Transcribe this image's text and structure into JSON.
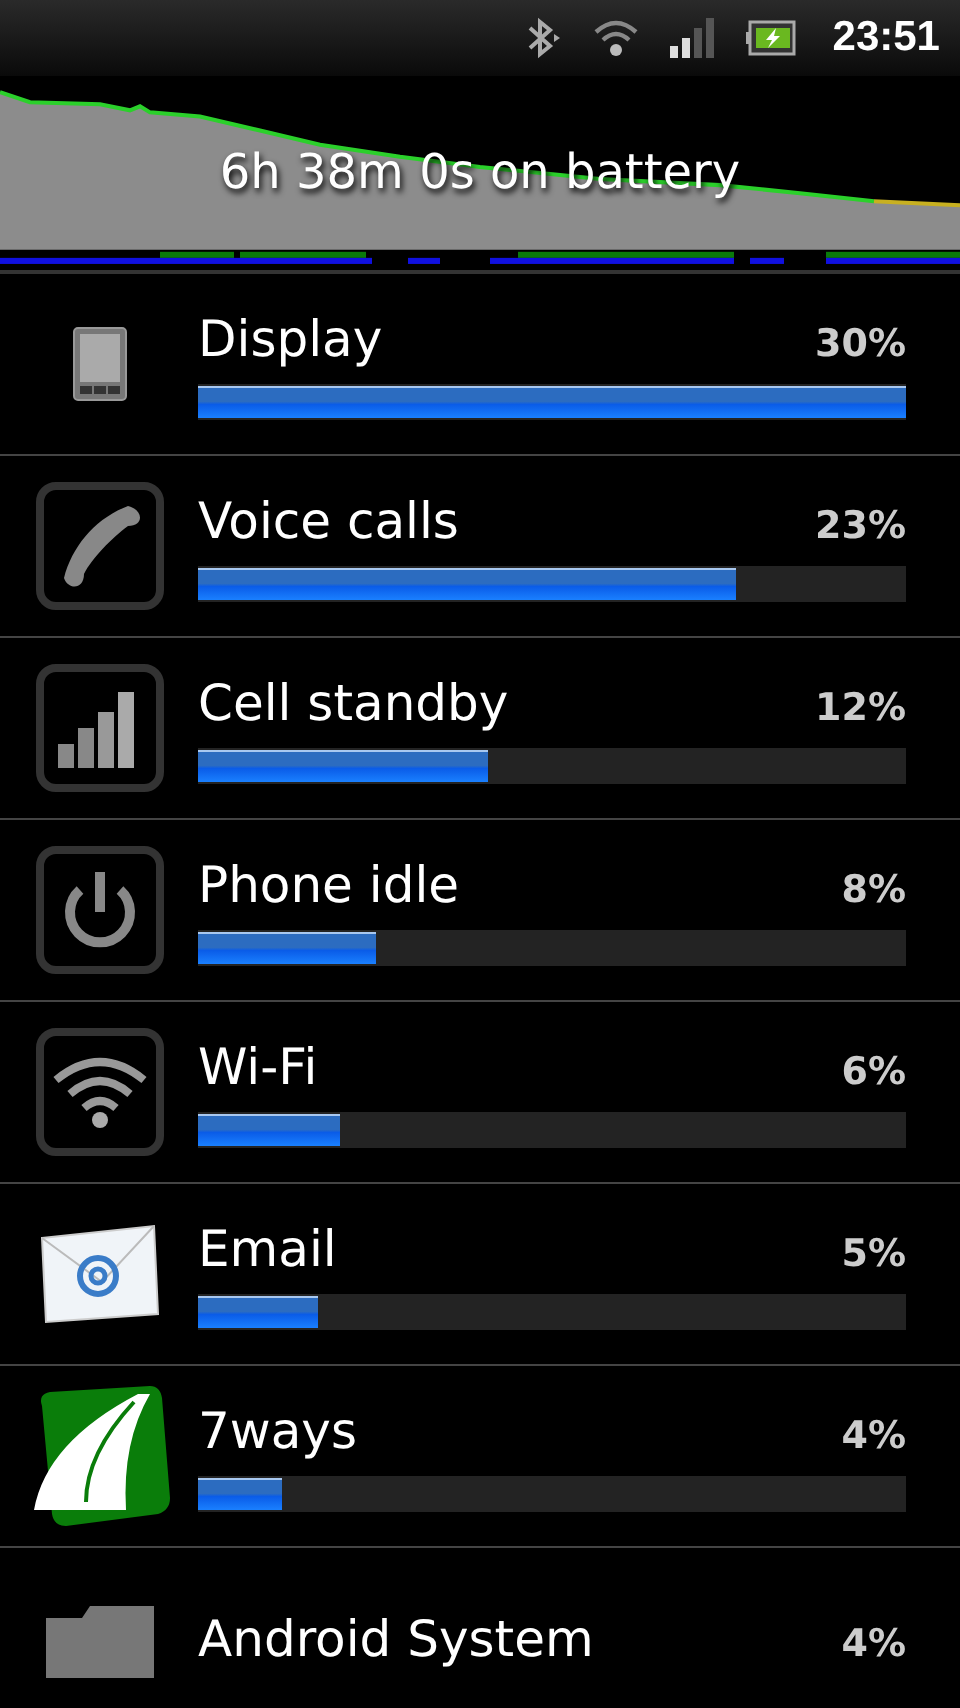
{
  "status_bar": {
    "time": "23:51"
  },
  "battery_graph": {
    "caption": "6h 38m 0s on battery"
  },
  "usage": [
    {
      "kind": "display",
      "name": "Display",
      "percent": "30%",
      "level": 1.0
    },
    {
      "kind": "phone",
      "name": "Voice calls",
      "percent": "23%",
      "level": 0.76
    },
    {
      "kind": "signal",
      "name": "Cell standby",
      "percent": "12%",
      "level": 0.41
    },
    {
      "kind": "power",
      "name": "Phone idle",
      "percent": "8%",
      "level": 0.25
    },
    {
      "kind": "wifi",
      "name": "Wi-Fi",
      "percent": "6%",
      "level": 0.2
    },
    {
      "kind": "email",
      "name": "Email",
      "percent": "5%",
      "level": 0.17
    },
    {
      "kind": "app",
      "name": "7ways",
      "percent": "4%",
      "level": 0.12
    },
    {
      "kind": "system",
      "name": "Android System",
      "percent": "4%"
    }
  ]
}
